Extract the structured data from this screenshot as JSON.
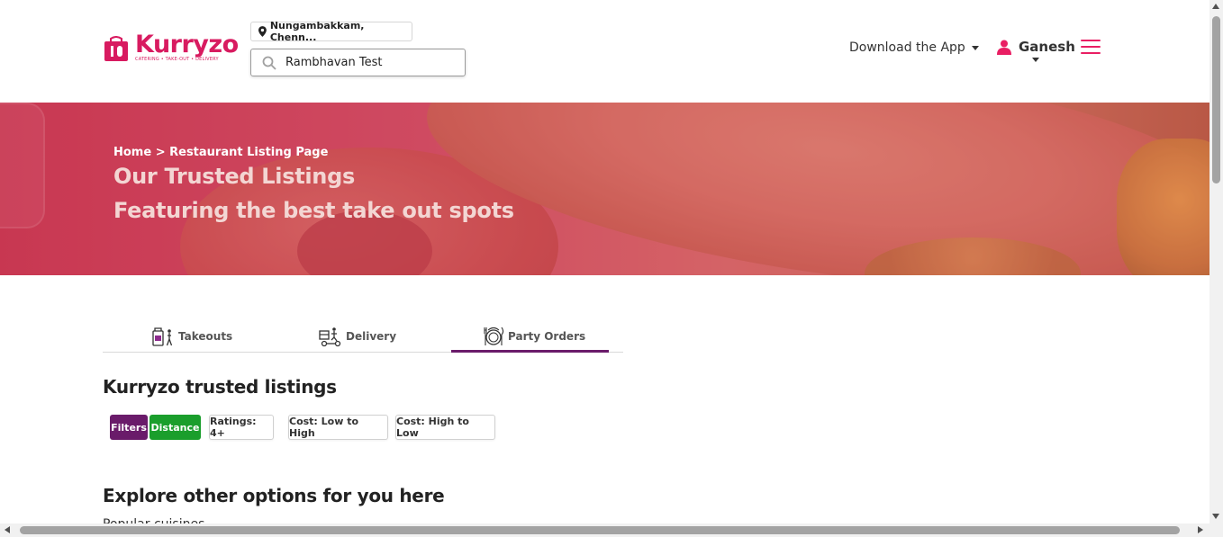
{
  "header": {
    "logo_text": "Kurryzo",
    "logo_tagline": "CATERING • TAKE-OUT • DELIVERY",
    "location": "Nungambakkam, Chenn...",
    "search_value": "Rambhavan Test",
    "download_label": "Download the App",
    "user_name": "Ganesh"
  },
  "banner": {
    "breadcrumb": "Home > Restaurant Listing Page",
    "title": "Our Trusted Listings",
    "subtitle": "Featuring the best take out spots"
  },
  "tabs": [
    {
      "label": "Takeouts",
      "icon": "takeout-icon",
      "active": false
    },
    {
      "label": "Delivery",
      "icon": "delivery-icon",
      "active": false
    },
    {
      "label": "Party Orders",
      "icon": "party-orders-icon",
      "active": true
    }
  ],
  "listings": {
    "title": "Kurryzo trusted listings",
    "chips": [
      {
        "label": "Filters",
        "style": "purple"
      },
      {
        "label": "Distance",
        "style": "green"
      },
      {
        "label": "Ratings: 4+",
        "style": "outline"
      },
      {
        "label": "Cost: Low to High",
        "style": "outline"
      },
      {
        "label": "Cost: High to Low",
        "style": "outline"
      }
    ]
  },
  "explore": {
    "title": "Explore other options for you here",
    "subtitle": "Popular cuisines"
  },
  "colors": {
    "brand": "#d81b60",
    "accent_purple": "#6a1b6a",
    "accent_green": "#1a9e2c"
  }
}
